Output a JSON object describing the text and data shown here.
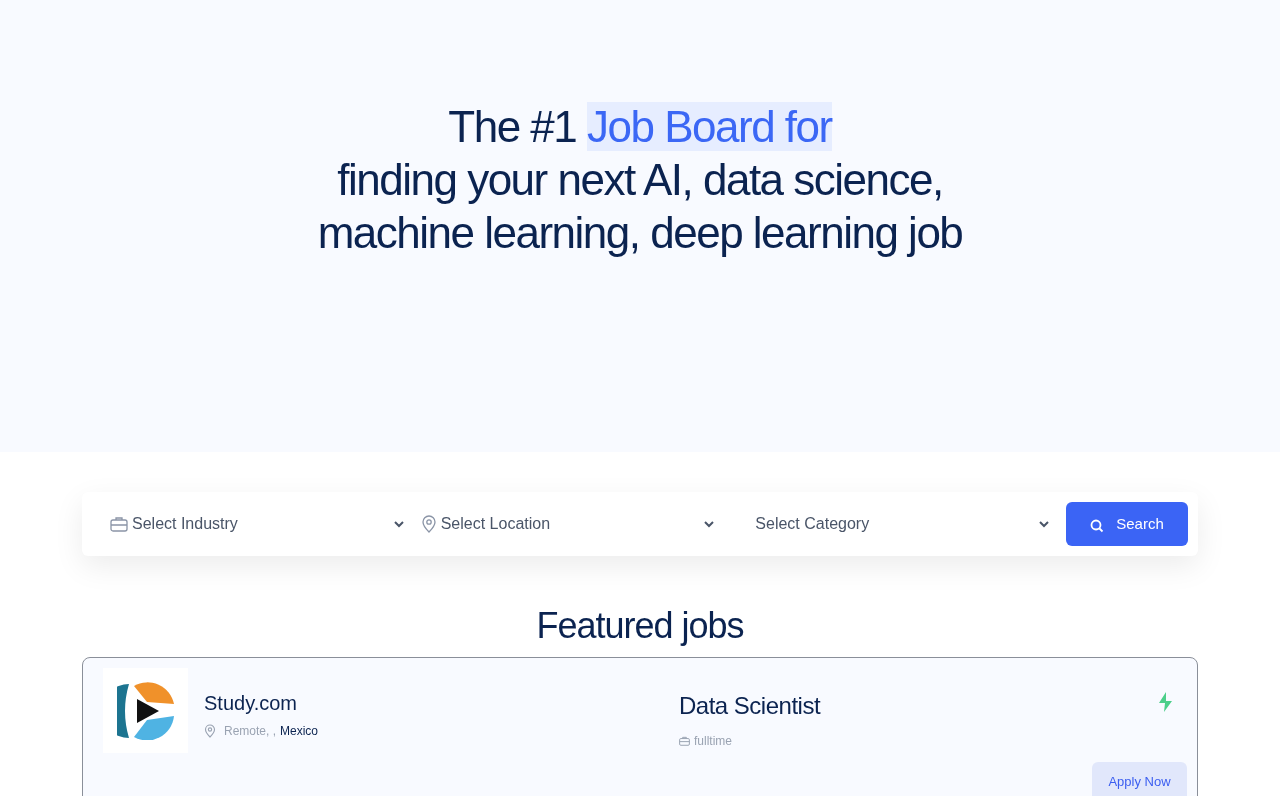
{
  "hero": {
    "title_lead": "The #1",
    "title_highlight": "Job Board for",
    "title_rest": "finding your next AI, data science, machine learning, deep learning job"
  },
  "search": {
    "filters": [
      {
        "kind": "industry",
        "placeholder": "Select Industry"
      },
      {
        "kind": "location",
        "placeholder": "Select Location"
      },
      {
        "kind": "category",
        "placeholder": "Select Category"
      }
    ],
    "button": "Search"
  },
  "featured": {
    "heading": "Featured jobs",
    "jobs": [
      {
        "company": "Study.com",
        "location": "Remote, ,",
        "country": "Mexico",
        "title": "Data Scientist",
        "type": "fulltime",
        "action": "Apply Now"
      }
    ]
  }
}
